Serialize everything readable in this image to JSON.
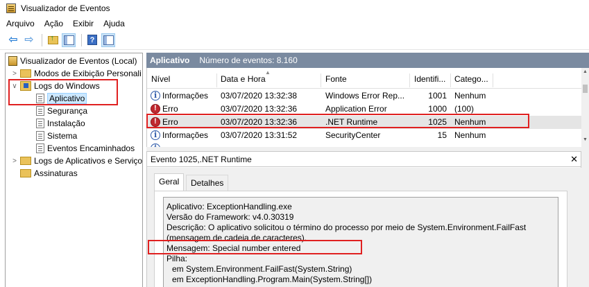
{
  "window": {
    "title": "Visualizador de Eventos"
  },
  "menu": {
    "items": [
      "Arquivo",
      "Ação",
      "Exibir",
      "Ajuda"
    ]
  },
  "toolbar": {
    "help_label": "?"
  },
  "tree": {
    "root": "Visualizador de Eventos (Local)",
    "custom_views": "Modos de Exibição Personali",
    "windows_logs": "Logs do Windows",
    "application": "Aplicativo",
    "security": "Segurança",
    "setup": "Instalação",
    "system": "Sistema",
    "forwarded": "Eventos Encaminhados",
    "app_services_logs": "Logs de Aplicativos e Serviço",
    "subscriptions": "Assinaturas"
  },
  "events": {
    "log_name": "Aplicativo",
    "count_text": "Número de eventos: 8.160",
    "columns": [
      "Nível",
      "Data e Hora",
      "Fonte",
      "Identifi...",
      "Catego..."
    ],
    "rows": [
      {
        "level": "Informações",
        "date": "03/07/2020 13:32:38",
        "source": "Windows Error Rep...",
        "id": "1001",
        "category": "Nenhum"
      },
      {
        "level": "Erro",
        "date": "03/07/2020 13:32:36",
        "source": "Application Error",
        "id": "1000",
        "category": "(100)"
      },
      {
        "level": "Erro",
        "date": "03/07/2020 13:32:36",
        "source": ".NET Runtime",
        "id": "1025",
        "category": "Nenhum"
      },
      {
        "level": "Informações",
        "date": "03/07/2020 13:31:52",
        "source": "SecurityCenter",
        "id": "15",
        "category": "Nenhum"
      }
    ]
  },
  "detail": {
    "title": "Evento 1025,.NET Runtime",
    "close": "✕",
    "tabs": [
      "Geral",
      "Detalhes"
    ],
    "lines": [
      "Aplicativo: ExceptionHandling.exe",
      "Versão do Framework: v4.0.30319",
      "Descrição: O aplicativo solicitou o término do processo por meio de System.Environment.FailFast",
      "(mensagem de cadeia de caracteres).",
      "Mensagem: Special number entered",
      "Pilha:",
      "em System.Environment.FailFast(System.String)",
      "em ExceptionHandling.Program.Main(System.String[])"
    ]
  },
  "colors": {
    "header_bg": "#7a8aa0",
    "highlight": "#e02020",
    "selection": "#cce8ff"
  }
}
